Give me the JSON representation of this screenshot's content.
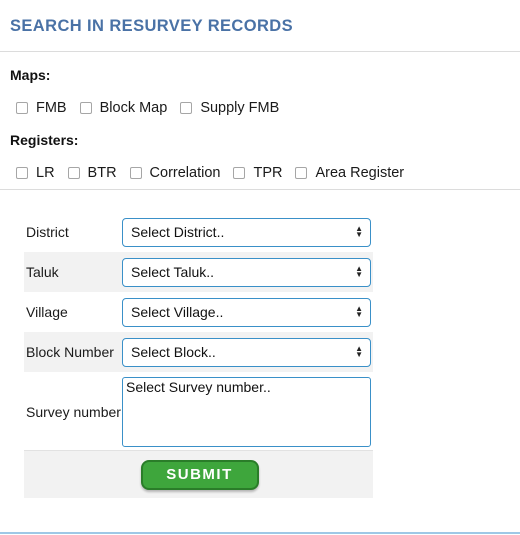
{
  "header": {
    "title": "SEARCH IN RESURVEY RECORDS"
  },
  "maps": {
    "label": "Maps:",
    "options": [
      "FMB",
      "Block Map",
      "Supply FMB"
    ]
  },
  "registers": {
    "label": "Registers:",
    "options": [
      "LR",
      "BTR",
      "Correlation",
      "TPR",
      "Area Register"
    ]
  },
  "form": {
    "district": {
      "label": "District",
      "value": "Select District.."
    },
    "taluk": {
      "label": "Taluk",
      "value": "Select Taluk.."
    },
    "village": {
      "label": "Village",
      "value": "Select Village.."
    },
    "block": {
      "label": "Block Number",
      "value": "Select Block.."
    },
    "survey": {
      "label": "Survey number",
      "value": "Select Survey number.."
    },
    "submit_label": "SUBMIT"
  },
  "colors": {
    "title": "#4a72a6",
    "input_border": "#3a90c8",
    "submit_bg": "#3ea63c",
    "row_alt": "#f2f2f2"
  }
}
